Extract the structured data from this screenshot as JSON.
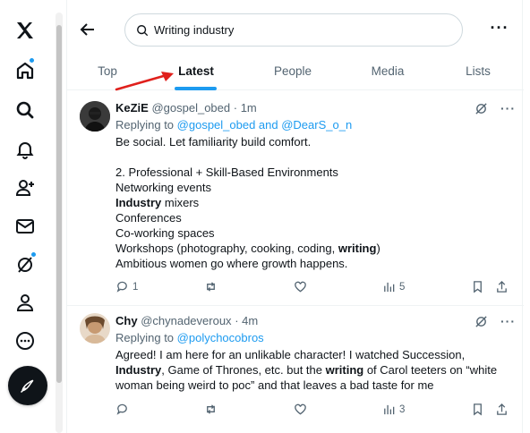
{
  "search": {
    "value": "Writing industry"
  },
  "tabs": [
    {
      "label": "Top"
    },
    {
      "label": "Latest"
    },
    {
      "label": "People"
    },
    {
      "label": "Media"
    },
    {
      "label": "Lists"
    }
  ],
  "colors": {
    "accent": "#1d9bf0",
    "arrow": "#e0201c",
    "text": "#0f1419",
    "muted": "#536471"
  },
  "tweets": [
    {
      "name": "KeZiE",
      "handle": "@gospel_obed",
      "time": "· 1m",
      "replying_prefix": "Replying to ",
      "replying_to": "@gospel_obed and @DearS_o_n",
      "lines": {
        "l1": "Be social. Let familiarity build comfort.",
        "l2": "2. Professional + Skill-Based Environments",
        "l3": "Networking events",
        "l4a": "Industry",
        "l4b": " mixers",
        "l5": "Conferences",
        "l6": "Co-working spaces",
        "l7a": "Workshops (photography, cooking, coding, ",
        "l7b": "writing",
        "l7c": ")",
        "l8": "Ambitious women go where growth happens."
      },
      "reply_count": "1",
      "views": "5"
    },
    {
      "name": "Chy",
      "handle": "@chynadeveroux",
      "time": "· 4m",
      "replying_prefix": "Replying to ",
      "replying_to": "@polychocobros",
      "lines": {
        "l1": "Agreed! I am here for an unlikable character! I watched Succession,",
        "l2a": "Industry",
        "l2b": ", Game of Thrones, etc. but the ",
        "l2c": "writing",
        "l2d": " of Carol teeters on “white",
        "l3": "woman being weird to poc” and that leaves a bad taste for me"
      },
      "views": "3"
    }
  ]
}
